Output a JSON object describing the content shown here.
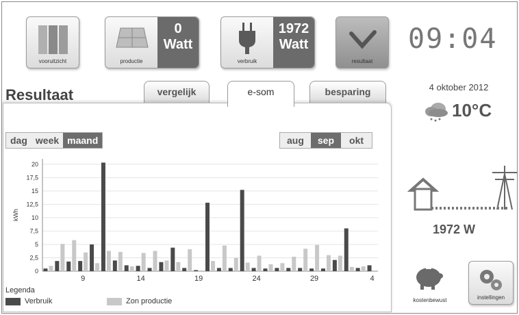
{
  "tiles": {
    "vooruitzicht": "vooruitzicht",
    "productie_label": "productie",
    "productie_value": "0",
    "productie_unit": "Watt",
    "verbruik_label": "verbruik",
    "verbruik_value": "1972",
    "verbruik_unit": "Watt",
    "resultaat": "resultaat"
  },
  "clock": "09:04",
  "weather": {
    "date": "4 oktober 2012",
    "temp": "10°C"
  },
  "grid": {
    "power": "1972 W"
  },
  "bottom": {
    "kostenbewust": "kostenbewust",
    "instellingen": "instellingen"
  },
  "page_title": "Resultaat",
  "tabs": [
    "vergelijk",
    "e-som",
    "besparing"
  ],
  "period": [
    "dag",
    "week",
    "maand"
  ],
  "months": [
    "aug",
    "sep",
    "okt"
  ],
  "legend": {
    "title": "Legenda",
    "verbruik": "Verbruik",
    "zon": "Zon productie"
  },
  "colors": {
    "verbruik": "#4a4a4a",
    "zon": "#c8c8c8",
    "accent": "#6d6d6d"
  },
  "chart_data": {
    "type": "bar",
    "ylabel": "kWh",
    "ylim": [
      0,
      21
    ],
    "yticks": [
      "0",
      "2,5",
      "5",
      "7,5",
      "10",
      "12,5",
      "15",
      "17,5",
      "20"
    ],
    "xticks": [
      {
        "label": "9",
        "at": 9
      },
      {
        "label": "14",
        "at": 14
      },
      {
        "label": "19",
        "at": 19
      },
      {
        "label": "24",
        "at": 24
      },
      {
        "label": "29",
        "at": 29
      },
      {
        "label": "4",
        "at": 34
      }
    ],
    "categories": [
      6,
      7,
      8,
      9,
      10,
      11,
      12,
      13,
      14,
      15,
      16,
      17,
      18,
      19,
      20,
      21,
      22,
      23,
      24,
      25,
      26,
      27,
      28,
      29,
      30,
      31,
      32,
      33,
      34
    ],
    "series": [
      {
        "name": "Verbruik",
        "values": [
          0.5,
          1.9,
          1.8,
          1.9,
          5.0,
          20.3,
          2.0,
          1.1,
          1.0,
          0.6,
          1.7,
          4.4,
          0.6,
          0.2,
          12.8,
          0.6,
          0.6,
          15.2,
          0.6,
          0.5,
          0.6,
          0.6,
          0.6,
          0.5,
          0.5,
          2.1,
          8.0,
          0.6,
          1.1
        ]
      },
      {
        "name": "Zon productie",
        "values": [
          1.0,
          5.1,
          5.8,
          3.5,
          1.5,
          3.8,
          3.6,
          0.9,
          3.4,
          3.8,
          2.0,
          1.7,
          4.1,
          0.0,
          1.9,
          4.8,
          2.5,
          1.6,
          2.9,
          1.3,
          1.5,
          2.7,
          4.2,
          4.9,
          3.0,
          2.9,
          0.8,
          0.9,
          0.0
        ]
      }
    ]
  }
}
